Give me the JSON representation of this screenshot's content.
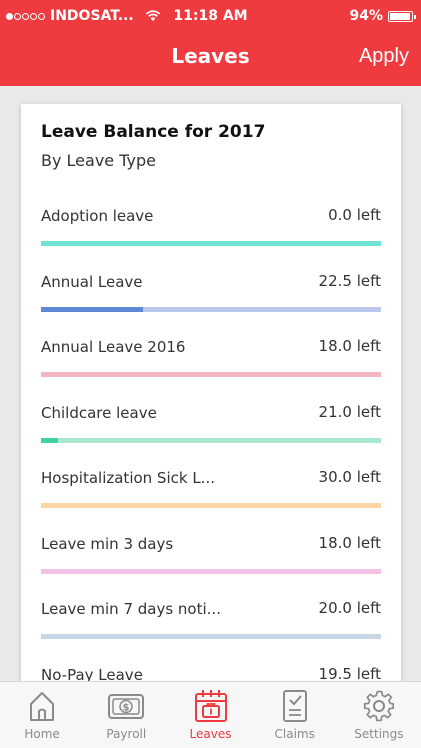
{
  "status_bar": {
    "carrier": "INDOSAT...",
    "time": "11:18 AM",
    "battery": "94%"
  },
  "header": {
    "title": "Leaves",
    "apply_label": "Apply",
    "accent_color": "#ef3b3f"
  },
  "card": {
    "title": "Leave Balance for 2017",
    "subtitle": "By Leave Type"
  },
  "leaves": [
    {
      "name": "Adoption leave",
      "left": "0.0 left",
      "used_fraction": 1.0,
      "track_color": "#6fe3d4",
      "fill_color": "#6fe3d4"
    },
    {
      "name": "Annual Leave",
      "left": "22.5 left",
      "used_fraction": 0.3,
      "track_color": "#b9c8ec",
      "fill_color": "#5f87d6"
    },
    {
      "name": "Annual Leave 2016",
      "left": "18.0 left",
      "used_fraction": 0.0,
      "track_color": "#f3b7c4",
      "fill_color": "#e0607c"
    },
    {
      "name": "Childcare leave",
      "left": "21.0 left",
      "used_fraction": 0.05,
      "track_color": "#a8e8cf",
      "fill_color": "#3ed39a"
    },
    {
      "name": "Hospitalization Sick L...",
      "left": "30.0 left",
      "used_fraction": 0.0,
      "track_color": "#fcd7a5",
      "fill_color": "#f5a23a"
    },
    {
      "name": "Leave min 3 days",
      "left": "18.0 left",
      "used_fraction": 0.0,
      "track_color": "#f3c2e6",
      "fill_color": "#d65cb8"
    },
    {
      "name": "Leave min 7 days noti...",
      "left": "20.0 left",
      "used_fraction": 0.0,
      "track_color": "#c9d6e6",
      "fill_color": "#7a9cc2"
    },
    {
      "name": "No-Pay Leave",
      "left": "19.5 left",
      "used_fraction": 0.0,
      "track_color": "#d9d9d9",
      "fill_color": "#999999"
    }
  ],
  "tabs": [
    {
      "label": "Home",
      "icon": "home-icon",
      "active": false
    },
    {
      "label": "Payroll",
      "icon": "money-icon",
      "active": false
    },
    {
      "label": "Leaves",
      "icon": "calendar-icon",
      "active": true
    },
    {
      "label": "Claims",
      "icon": "clipboard-icon",
      "active": false
    },
    {
      "label": "Settings",
      "icon": "gear-icon",
      "active": false
    }
  ]
}
